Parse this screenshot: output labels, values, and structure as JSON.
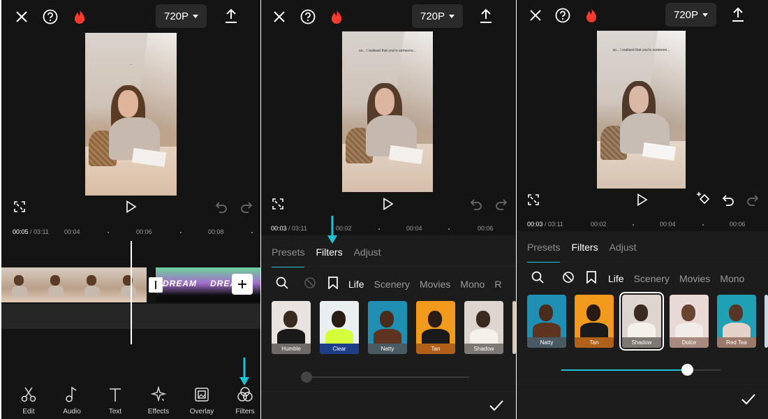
{
  "panels": [
    {
      "id": "timeline",
      "resolution": "720P",
      "current_time": "00:05",
      "total_time": "03:11",
      "ticks": [
        "00:04",
        "00:06",
        "00:08"
      ],
      "clip_overlay_text": "DREAM",
      "toolbar": [
        {
          "label": "Edit",
          "icon": "scissors-icon"
        },
        {
          "label": "Audio",
          "icon": "music-note-icon"
        },
        {
          "label": "Text",
          "icon": "text-icon"
        },
        {
          "label": "Effects",
          "icon": "sparkle-icon"
        },
        {
          "label": "Overlay",
          "icon": "overlay-icon"
        },
        {
          "label": "Filters",
          "icon": "filters-icon"
        }
      ],
      "video_caption": "..."
    },
    {
      "id": "filters-default",
      "resolution": "720P",
      "current_time": "00:03",
      "total_time": "03:11",
      "ticks": [
        "00:02",
        "00:04",
        "00:06"
      ],
      "tabs": [
        "Presets",
        "Filters",
        "Adjust"
      ],
      "active_tab": "Filters",
      "categories": [
        "Life",
        "Scenery",
        "Movies",
        "Mono",
        "R"
      ],
      "thumbnails": [
        {
          "label": "Humble",
          "bg": "#e8e3df",
          "label_bg": "#6f6a66"
        },
        {
          "label": "Clear",
          "bg": "#e9eef0",
          "label_bg": "#1e3f87"
        },
        {
          "label": "Natty",
          "bg": "#1f8fb4",
          "label_bg": "#4a5a63"
        },
        {
          "label": "Tan",
          "bg": "#f29a1c",
          "label_bg": "#b06018"
        },
        {
          "label": "Shadow",
          "bg": "#ddd6ce",
          "label_bg": "#7e7872"
        }
      ],
      "video_caption": "so... I realised that you're someone..."
    },
    {
      "id": "filters-applied",
      "resolution": "720P",
      "current_time": "00:03",
      "total_time": "03:11",
      "ticks": [
        "00:02",
        "00:04",
        "00:06"
      ],
      "tabs": [
        "Presets",
        "Filters",
        "Adjust"
      ],
      "active_tab": "Filters",
      "categories": [
        "Life",
        "Scenery",
        "Movies",
        "Mono"
      ],
      "thumbnails": [
        {
          "label": "Natty",
          "bg": "#1f8fb4",
          "label_bg": "#4a5a63"
        },
        {
          "label": "Tan",
          "bg": "#f29a1c",
          "label_bg": "#b06018"
        },
        {
          "label": "Shadow",
          "bg": "#ddd6ce",
          "label_bg": "#7e7872"
        },
        {
          "label": "Dolce",
          "bg": "#e9d9d6",
          "label_bg": "#a88a80"
        },
        {
          "label": "Red Tea",
          "bg": "#1fa0b5",
          "label_bg": "#9b7a6c"
        }
      ],
      "selected_thumbnail": "Shadow",
      "intensity": 0.79,
      "video_caption": "so... I realised that you're someone..."
    }
  ],
  "accent_color": "#1cc3d6"
}
